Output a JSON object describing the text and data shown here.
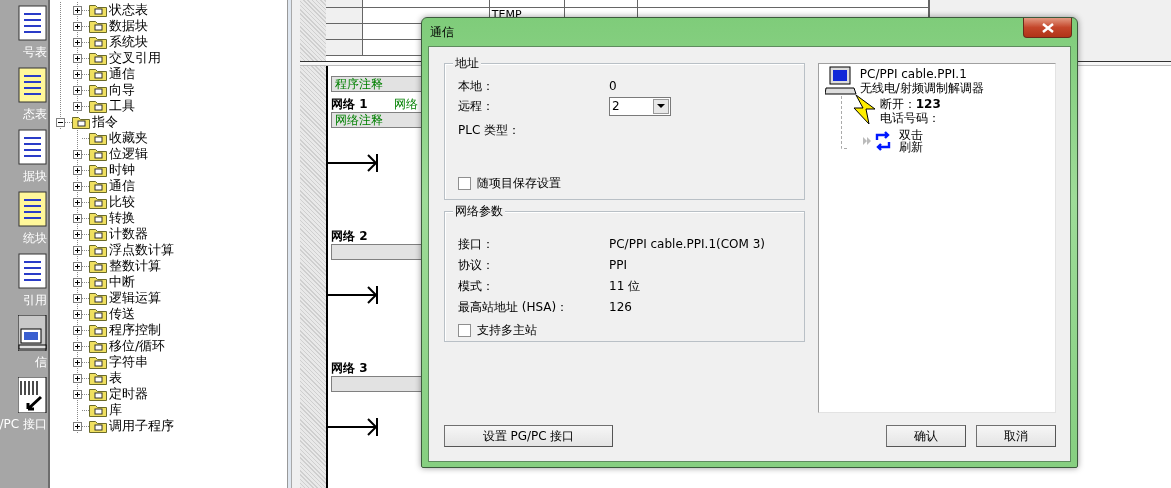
{
  "sidebar": {
    "items": [
      {
        "label": "号表"
      },
      {
        "label": "态表"
      },
      {
        "label": "据块"
      },
      {
        "label": "统块"
      },
      {
        "label": "引用"
      },
      {
        "label": "信"
      },
      {
        "label": "/PC 接口"
      }
    ]
  },
  "tree": {
    "partial_branch": [
      {
        "label": "状态表",
        "expanded": false
      },
      {
        "label": "数据块",
        "expanded": false
      },
      {
        "label": "系统块",
        "expanded": false
      },
      {
        "label": "交叉引用",
        "expanded": false
      },
      {
        "label": "通信",
        "expanded": false
      },
      {
        "label": "向导",
        "expanded": false
      },
      {
        "label": "工具",
        "expanded": false
      }
    ],
    "items": [
      {
        "label": "指令",
        "expanded": true,
        "children": [
          {
            "label": "收藏夹",
            "kind": "leaf"
          },
          {
            "label": "位逻辑",
            "kind": "folder",
            "expanded": false
          },
          {
            "label": "时钟",
            "kind": "folder",
            "expanded": false
          },
          {
            "label": "通信",
            "kind": "folder",
            "expanded": false
          },
          {
            "label": "比较",
            "kind": "folder",
            "expanded": false
          },
          {
            "label": "转换",
            "kind": "folder",
            "expanded": false
          },
          {
            "label": "计数器",
            "kind": "folder",
            "expanded": false
          },
          {
            "label": "浮点数计算",
            "kind": "folder",
            "expanded": false
          },
          {
            "label": "整数计算",
            "kind": "folder",
            "expanded": false
          },
          {
            "label": "中断",
            "kind": "folder",
            "expanded": false
          },
          {
            "label": "逻辑运算",
            "kind": "folder",
            "expanded": false
          },
          {
            "label": "传送",
            "kind": "folder",
            "expanded": false
          },
          {
            "label": "程序控制",
            "kind": "folder",
            "expanded": false
          },
          {
            "label": "移位/循环",
            "kind": "folder",
            "expanded": false
          },
          {
            "label": "字符串",
            "kind": "folder",
            "expanded": false
          },
          {
            "label": "表",
            "kind": "folder",
            "expanded": false
          },
          {
            "label": "定时器",
            "kind": "folder",
            "expanded": false
          },
          {
            "label": "库",
            "kind": "leaf"
          },
          {
            "label": "调用子程序",
            "kind": "folder",
            "expanded": false
          }
        ]
      }
    ]
  },
  "editor": {
    "variable_table": {
      "rows": [
        {
          "type": "TEMP"
        }
      ]
    },
    "program_comment": "程序注释",
    "networks": [
      {
        "title": "网络 1",
        "caption": "网络",
        "comment": "网络注释"
      },
      {
        "title": "网络 2"
      },
      {
        "title": "网络 3"
      }
    ]
  },
  "dialog": {
    "title": "通信",
    "address_group": {
      "title": "地址",
      "local_label": "本地：",
      "local_value": "0",
      "remote_label": "远程：",
      "remote_value": "2",
      "plc_type_label": "PLC 类型：",
      "save_checkbox": {
        "label": "随项目保存设置",
        "checked": false
      }
    },
    "network_group": {
      "title": "网络参数",
      "rows": [
        {
          "label": "接口：",
          "value": "PC/PPI cable.PPI.1(COM 3)"
        },
        {
          "label": "协议：",
          "value": "PPI"
        },
        {
          "label": "模式：",
          "value": "11 位"
        },
        {
          "label": "最高站地址 (HSA)：",
          "value": "126"
        }
      ],
      "multi_master_checkbox": {
        "label": "支持多主站",
        "checked": false
      }
    },
    "device_panel": {
      "device_name": "PC/PPI cable.PPI.1",
      "device_type": "无线电/射频调制解调器",
      "status": "断开：**123**",
      "phone_label": "电话号码：",
      "refresh_label": "双击刷新"
    },
    "pgpc_button": "设置 PG/PC 接口",
    "buttons": [
      "确认",
      "取消"
    ]
  }
}
